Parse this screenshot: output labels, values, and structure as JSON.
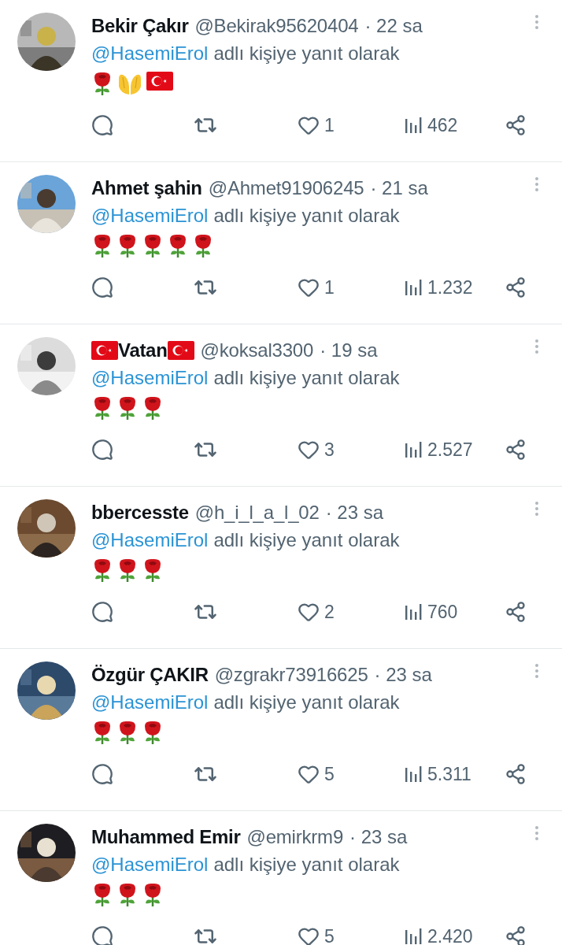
{
  "replies": [
    {
      "name": "Bekir Çakır",
      "flagged_name": false,
      "handle": "@Bekirak95620404",
      "time": "· 22 sa",
      "mention": "@HasemiErol",
      "reply_text": "adlı kişiye yanıt olarak",
      "emojis": [
        {
          "kind": "rose"
        },
        {
          "kind": "palms"
        },
        {
          "kind": "flag"
        }
      ],
      "likes": "1",
      "views": "462"
    },
    {
      "name": "Ahmet şahin",
      "flagged_name": false,
      "handle": "@Ahmet91906245",
      "time": "· 21 sa",
      "mention": "@HasemiErol",
      "reply_text": "adlı kişiye yanıt olarak",
      "emojis": [
        {
          "kind": "rose"
        },
        {
          "kind": "rose"
        },
        {
          "kind": "rose"
        },
        {
          "kind": "rose"
        },
        {
          "kind": "rose"
        }
      ],
      "likes": "1",
      "views": "1.232"
    },
    {
      "name": "Vatan",
      "flagged_name": true,
      "handle": "@koksal3300",
      "time": "· 19 sa",
      "mention": "@HasemiErol",
      "reply_text": "adlı kişiye yanıt olarak",
      "emojis": [
        {
          "kind": "rose"
        },
        {
          "kind": "rose"
        },
        {
          "kind": "rose"
        }
      ],
      "likes": "3",
      "views": "2.527"
    },
    {
      "name": "bbercesste",
      "flagged_name": false,
      "handle": "@h_i_l_a_l_02",
      "time": "· 23 sa",
      "mention": "@HasemiErol",
      "reply_text": "adlı kişiye yanıt olarak",
      "emojis": [
        {
          "kind": "rose"
        },
        {
          "kind": "rose"
        },
        {
          "kind": "rose"
        }
      ],
      "likes": "2",
      "views": "760"
    },
    {
      "name": "Özgür ÇAKIR",
      "flagged_name": false,
      "handle": "@zgrakr73916625",
      "time": "· 23 sa",
      "mention": "@HasemiErol",
      "reply_text": "adlı kişiye yanıt olarak",
      "emojis": [
        {
          "kind": "rose"
        },
        {
          "kind": "rose"
        },
        {
          "kind": "rose"
        }
      ],
      "likes": "5",
      "views": "5.311"
    },
    {
      "name": "Muhammed Emir",
      "flagged_name": false,
      "handle": "@emirkrm9",
      "time": "· 23 sa",
      "mention": "@HasemiErol",
      "reply_text": "adlı kişiye yanıt olarak",
      "emojis": [
        {
          "kind": "rose"
        },
        {
          "kind": "rose"
        },
        {
          "kind": "rose"
        }
      ],
      "likes": "5",
      "views": "2.420"
    }
  ]
}
